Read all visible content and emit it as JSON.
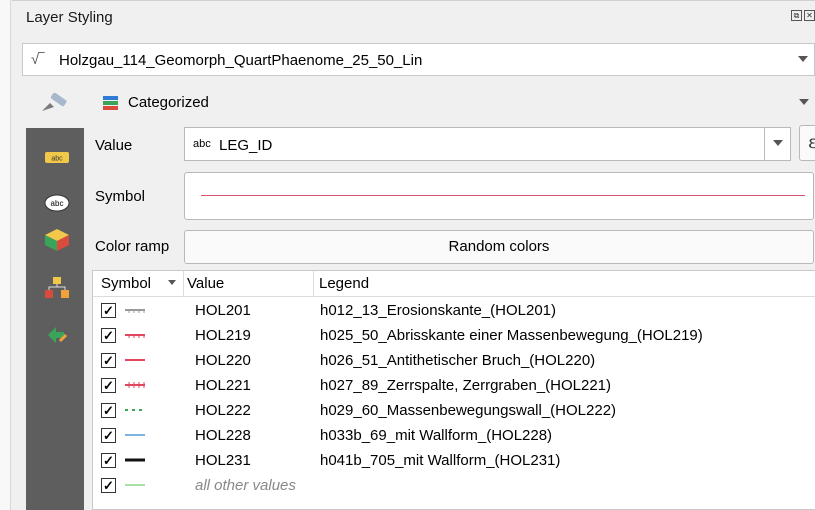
{
  "panel": {
    "title": "Layer Styling",
    "float_btn": "⧉",
    "close_btn": "✕"
  },
  "layer": {
    "name": "Holzgau_114_Geomorph_QuartPhaenome_25_50_Lin",
    "icon": "line-layer-icon"
  },
  "renderer": {
    "selected": "Categorized",
    "icon": "categorized-renderer-icon"
  },
  "form": {
    "value_label": "Value",
    "value_type": "abc",
    "value_field": "LEG_ID",
    "expression_btn": "ε",
    "symbol_label": "Symbol",
    "color_ramp_label": "Color ramp",
    "color_ramp_value": "Random colors"
  },
  "colors": {
    "sidebar": "#5e5e5e",
    "symbol_line": "#d2566a"
  },
  "table": {
    "headers": [
      "Symbol",
      "Value",
      "Legend"
    ],
    "rows": [
      {
        "checked": "✓",
        "value": "HOL201",
        "legend": "h012_13_Erosionskante_(HOL201)",
        "symbol_color": "#9a9a9a",
        "symbol_style": "ticked"
      },
      {
        "checked": "✓",
        "value": "HOL219",
        "legend": "h025_50_Abrisskante einer Massenbewegung_(HOL219)",
        "symbol_color": "#e0475f",
        "symbol_style": "ticked"
      },
      {
        "checked": "✓",
        "value": "HOL220",
        "legend": "h026_51_Antithetischer Bruch_(HOL220)",
        "symbol_color": "#e0475f",
        "symbol_style": "solid"
      },
      {
        "checked": "✓",
        "value": "HOL221",
        "legend": "h027_89_Zerrspalte, Zerrgraben_(HOL221)",
        "symbol_color": "#e0475f",
        "symbol_style": "crossed"
      },
      {
        "checked": "✓",
        "value": "HOL222",
        "legend": "h029_60_Massenbewegungswall_(HOL222)",
        "symbol_color": "#3aa55a",
        "symbol_style": "dashed"
      },
      {
        "checked": "✓",
        "value": "HOL228",
        "legend": "h033b_69_mit Wallform_(HOL228)",
        "symbol_color": "#7fb3e0",
        "symbol_style": "solid"
      },
      {
        "checked": "✓",
        "value": "HOL231",
        "legend": "h041b_705_mit Wallform_(HOL231)",
        "symbol_color": "#111111",
        "symbol_style": "thick"
      }
    ],
    "other": {
      "checked": "✓",
      "label": "all other values",
      "symbol_color": "#a8e0a8"
    }
  }
}
